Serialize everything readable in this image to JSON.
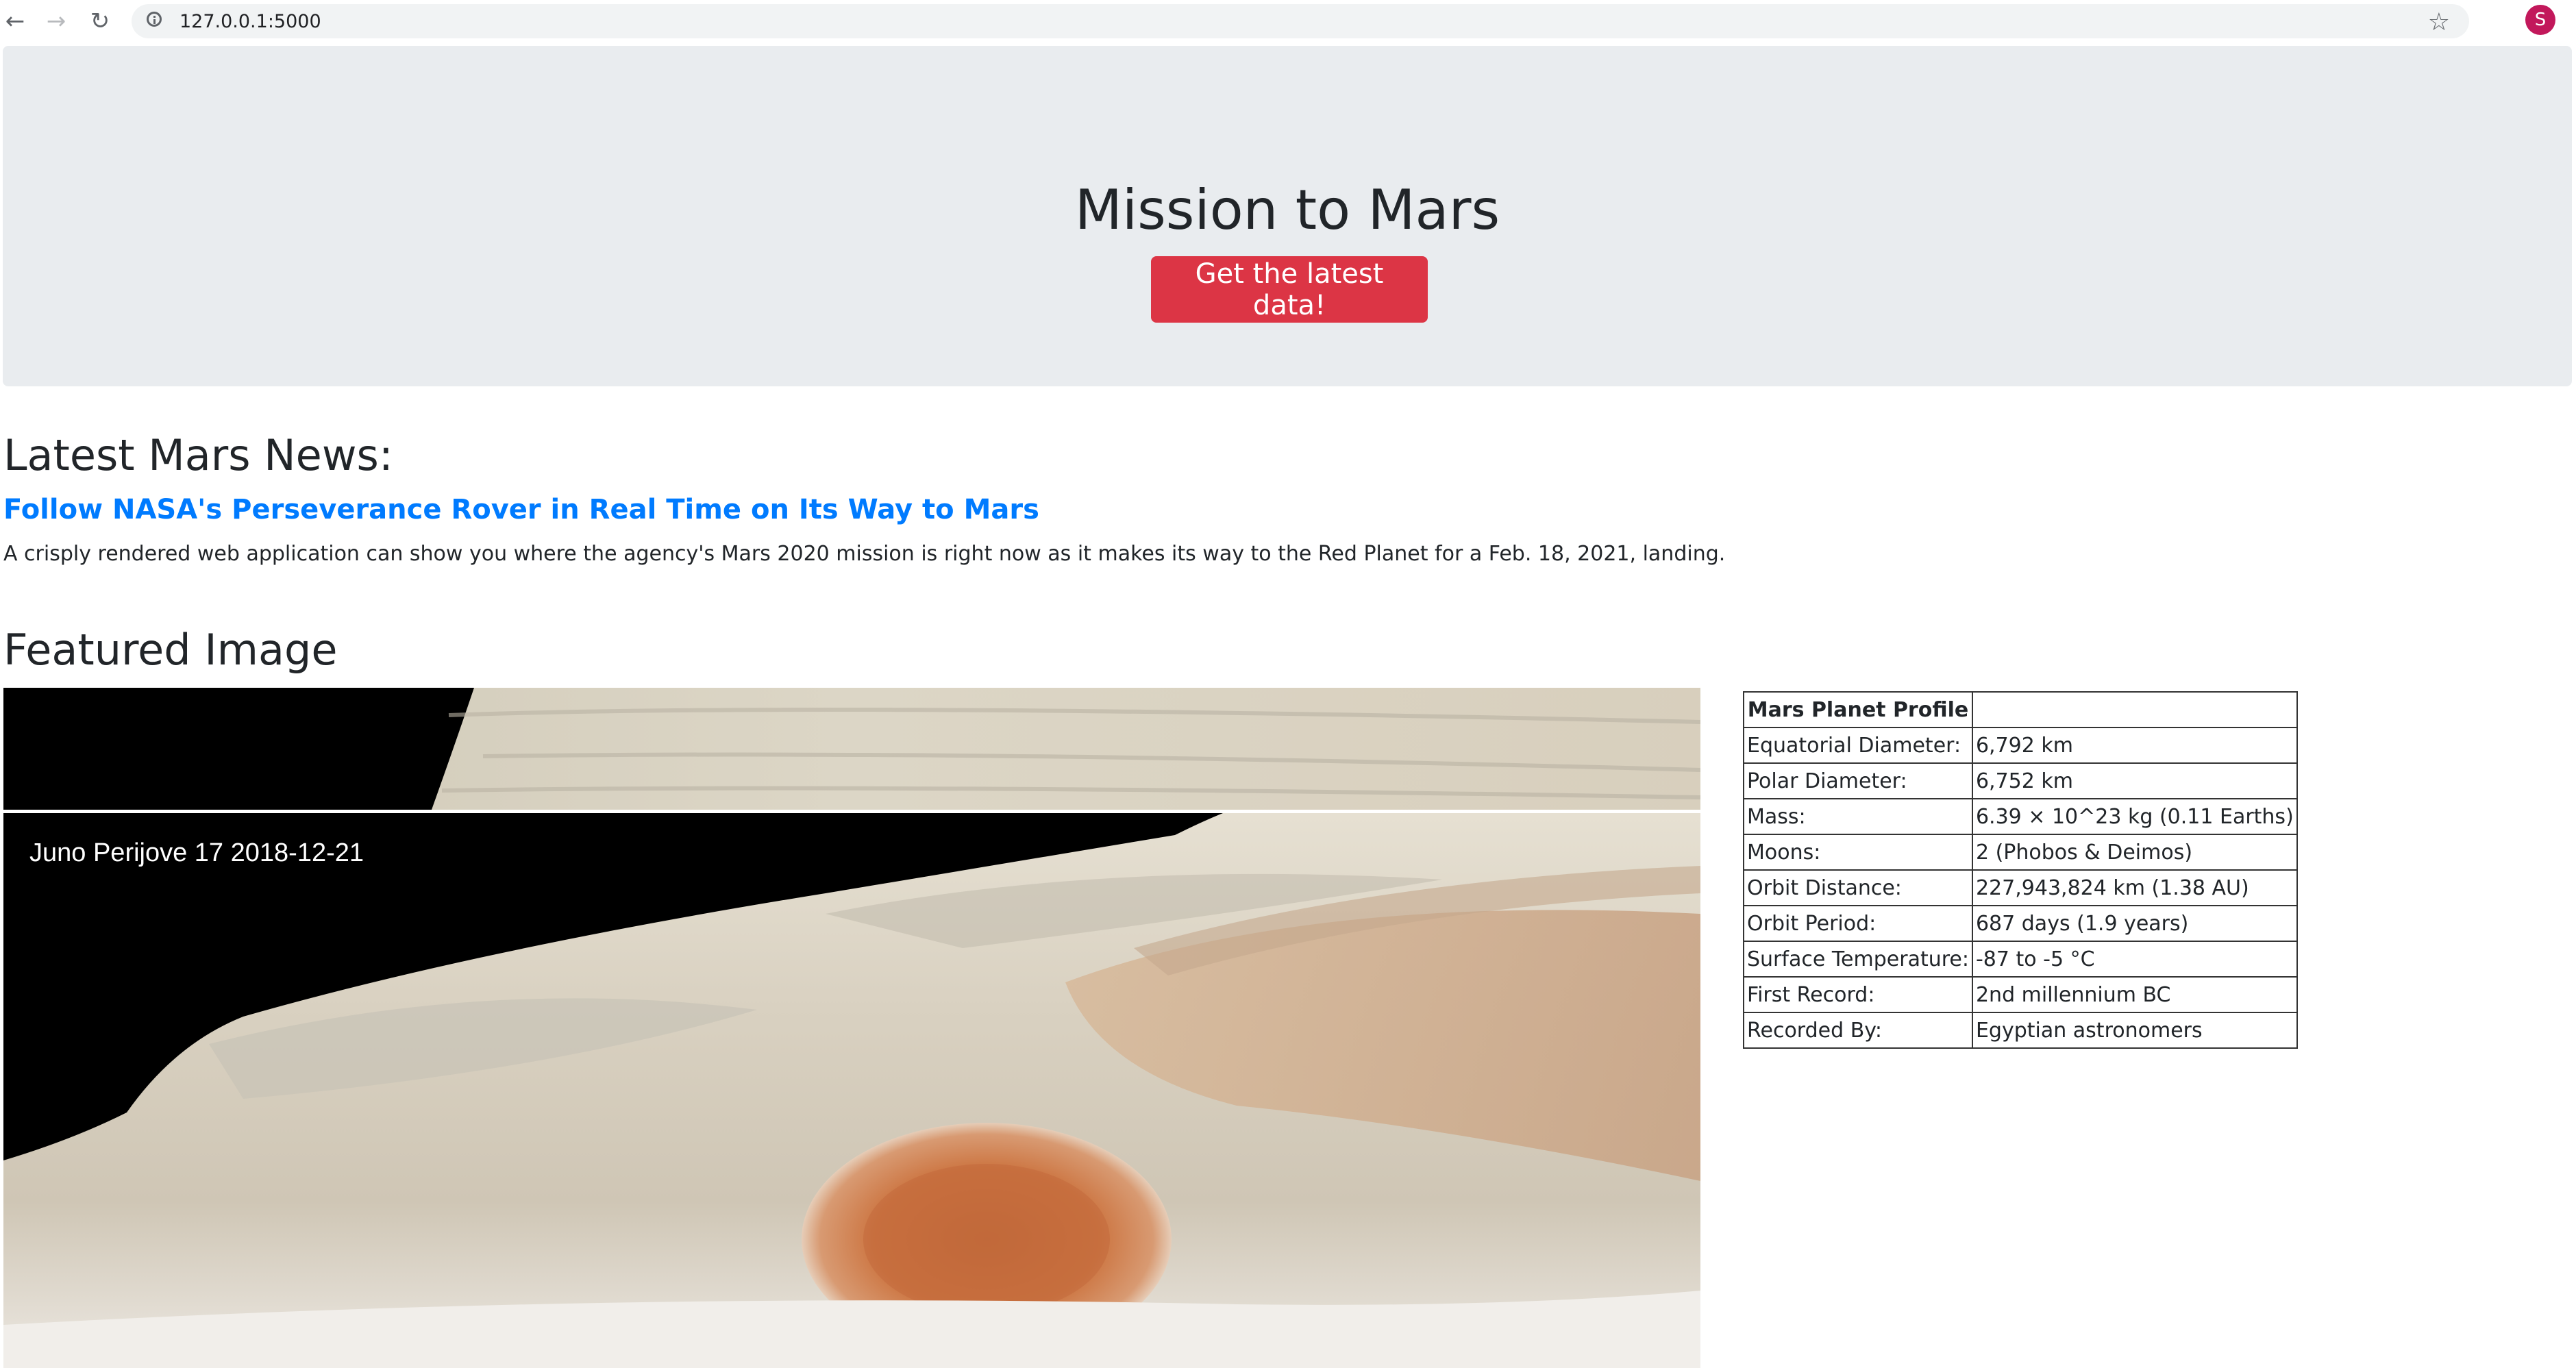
{
  "browser": {
    "url": "127.0.0.1:5000",
    "profile_initial": "S",
    "profile_color": "#c2185b"
  },
  "jumbotron": {
    "title": "Mission to Mars",
    "button_label": "Get the latest data!",
    "button_color": "#dc3545"
  },
  "news": {
    "heading": "Latest Mars News:",
    "title": "Follow NASA's Perseverance Rover in Real Time on Its Way to Mars",
    "teaser": "A crisply rendered web application can show you where the agency's Mars 2020 mission is right now as it makes its way to the Red Planet for a Feb. 18, 2021, landing.",
    "link_color": "#007bff"
  },
  "featured": {
    "heading": "Featured Image",
    "caption": "Juno Perijove 17 2018-12-21"
  },
  "facts": {
    "header_label": "Mars Planet Profile",
    "header_value": "",
    "rows": [
      {
        "label": "Equatorial Diameter:",
        "value": "6,792 km"
      },
      {
        "label": "Polar Diameter:",
        "value": "6,752 km"
      },
      {
        "label": "Mass:",
        "value": "6.39 × 10^23 kg (0.11 Earths)"
      },
      {
        "label": "Moons:",
        "value": "2 (Phobos & Deimos)"
      },
      {
        "label": "Orbit Distance:",
        "value": "227,943,824 km (1.38 AU)"
      },
      {
        "label": "Orbit Period:",
        "value": "687 days (1.9 years)"
      },
      {
        "label": "Surface Temperature:",
        "value": "-87 to -5 °C"
      },
      {
        "label": "First Record:",
        "value": "2nd millennium BC"
      },
      {
        "label": "Recorded By:",
        "value": "Egyptian astronomers"
      }
    ]
  }
}
